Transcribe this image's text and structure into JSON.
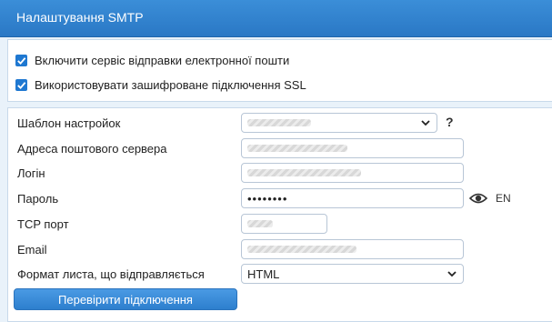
{
  "header": {
    "title": "Налаштування SMTP"
  },
  "options": [
    {
      "label": "Включити сервіс відправки електронної пошти",
      "checked": true
    },
    {
      "label": "Використовувати зашифроване підключення SSL",
      "checked": true
    }
  ],
  "form": {
    "template": {
      "label": "Шаблон настройок",
      "help": "?"
    },
    "server": {
      "label": "Адреса поштового сервера"
    },
    "login": {
      "label": "Логін"
    },
    "password": {
      "label": "Пароль",
      "value": "••••••••",
      "lang": "EN"
    },
    "port": {
      "label": "TCP порт"
    },
    "email": {
      "label": "Email"
    },
    "format": {
      "label": "Формат листа, що відправляється",
      "value": "HTML"
    }
  },
  "actions": {
    "test_label": "Перевірити підключення"
  },
  "colors": {
    "accent": "#2a78c5",
    "checkbox": "#1f78d1",
    "background": "#e9f2fa"
  },
  "icons": [
    "check-icon",
    "chevron-down-icon",
    "help-icon",
    "eye-icon"
  ]
}
